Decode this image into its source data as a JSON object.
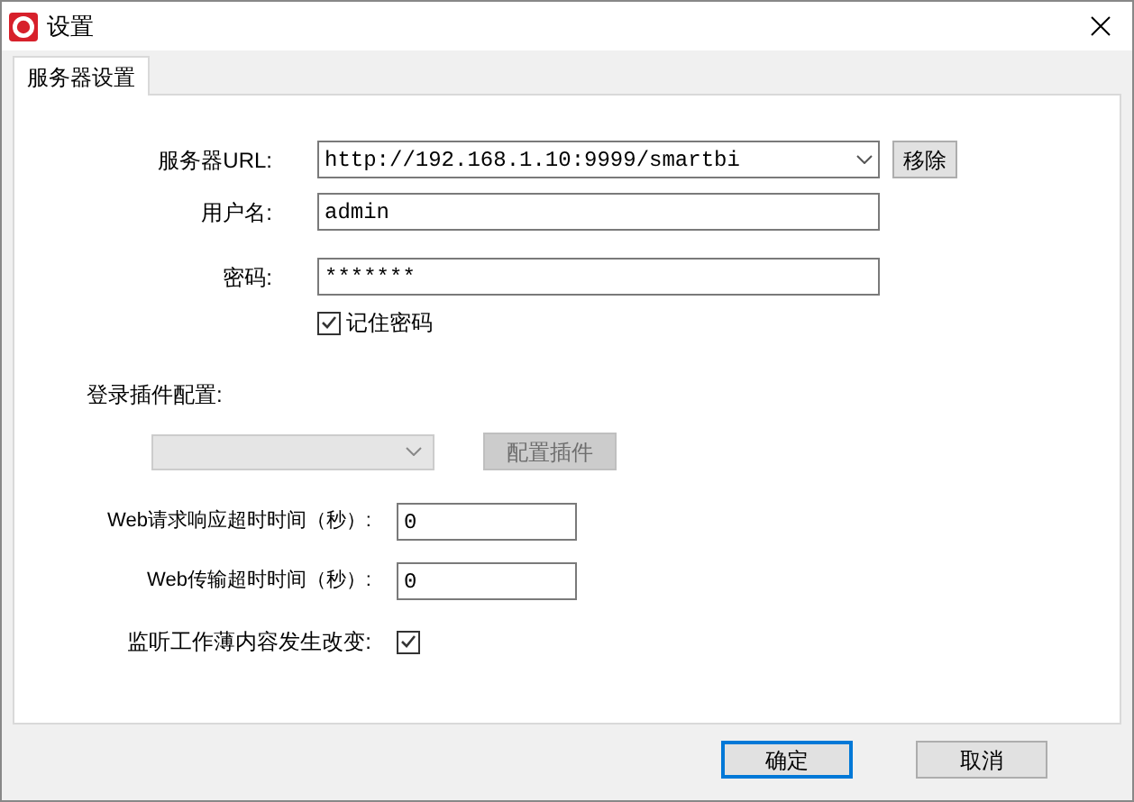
{
  "window": {
    "title": "设置"
  },
  "tabs": [
    {
      "label": "服务器设置",
      "selected": true
    }
  ],
  "server": {
    "url_label": "服务器URL:",
    "url_value": "http://192.168.1.10:9999/smartbi",
    "remove_button": "移除",
    "user_label": "用户名:",
    "user_value": "admin",
    "password_label": "密码:",
    "password_value": "*******",
    "remember": {
      "label": "记住密码",
      "checked": true
    }
  },
  "plugin": {
    "label": "登录插件配置:",
    "select_disabled": true,
    "button": "配置插件",
    "button_disabled": true
  },
  "timeouts": [
    {
      "label": "Web请求响应超时时间（秒）:",
      "value": "0"
    },
    {
      "label": "Web传输超时时间（秒）:",
      "value": "0"
    }
  ],
  "watch": {
    "label": "监听工作薄内容发生改变:",
    "checked": true
  },
  "buttons": [
    {
      "label": "确定",
      "selected": true
    },
    {
      "label": "取消",
      "selected": false
    }
  ]
}
